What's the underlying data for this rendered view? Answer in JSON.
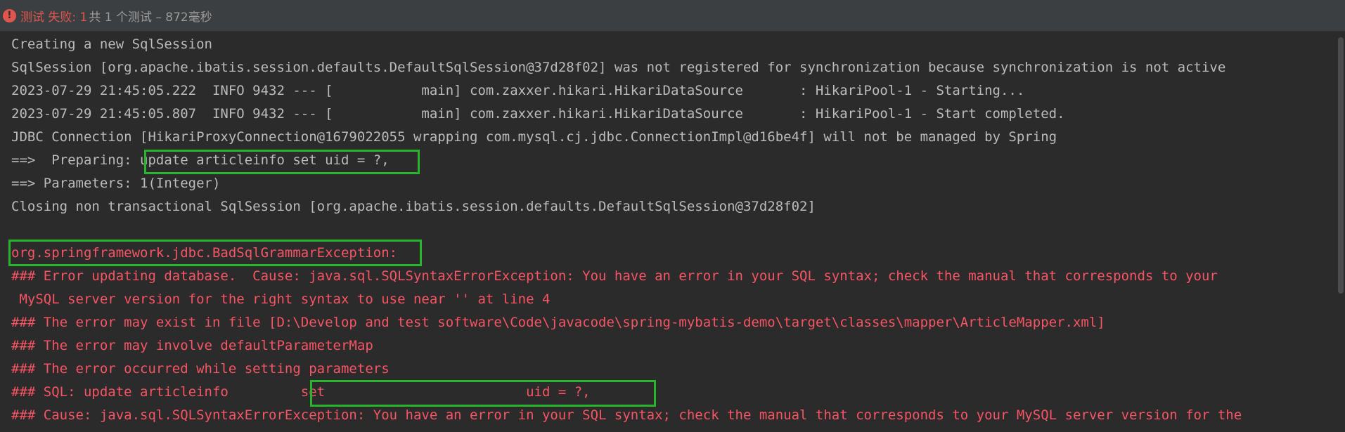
{
  "status": {
    "icon": "!",
    "fail_text": "测试 失败: 1",
    "summary_text": "共 1 个测试 – 872毫秒"
  },
  "console": {
    "lines": [
      "Creating a new SqlSession",
      "SqlSession [org.apache.ibatis.session.defaults.DefaultSqlSession@37d28f02] was not registered for synchronization because synchronization is not active",
      "2023-07-29 21:45:05.222  INFO 9432 --- [           main] com.zaxxer.hikari.HikariDataSource       : HikariPool-1 - Starting...",
      "2023-07-29 21:45:05.807  INFO 9432 --- [           main] com.zaxxer.hikari.HikariDataSource       : HikariPool-1 - Start completed.",
      "JDBC Connection [HikariProxyConnection@1679022055 wrapping com.mysql.cj.jdbc.ConnectionImpl@d16be4f] will not be managed by Spring",
      "==>  Preparing: update articleinfo set uid = ?,",
      "==> Parameters: 1(Integer)",
      "Closing non transactional SqlSession [org.apache.ibatis.session.defaults.DefaultSqlSession@37d28f02]",
      "",
      "org.springframework.jdbc.BadSqlGrammarException:",
      "### Error updating database.  Cause: java.sql.SQLSyntaxErrorException: You have an error in your SQL syntax; check the manual that corresponds to your",
      " MySQL server version for the right syntax to use near '' at line 4",
      "### The error may exist in file [D:\\Develop and test software\\Code\\javacode\\spring-mybatis-demo\\target\\classes\\mapper\\ArticleMapper.xml]",
      "### The error may involve defaultParameterMap",
      "### The error occurred while setting parameters",
      "### SQL: update articleinfo         set                         uid = ?,",
      "### Cause: java.sql.SQLSyntaxErrorException: You have an error in your SQL syntax; check the manual that corresponds to your MySQL server version for the"
    ]
  },
  "colors": {
    "background": "#2b2b2b",
    "normal_text": "#bbbbbb",
    "error_text": "#f75464",
    "highlight_box": "#27b52b",
    "fail_red": "#e0564e"
  }
}
